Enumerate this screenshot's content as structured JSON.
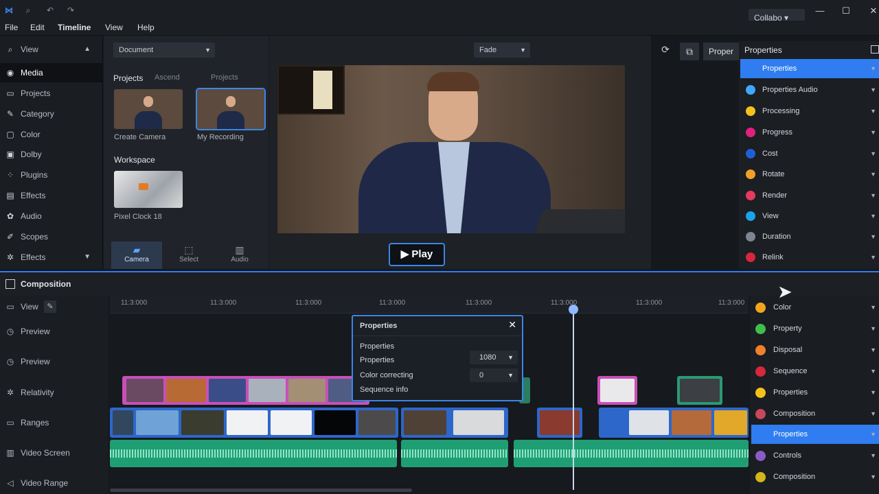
{
  "menu": [
    "File",
    "Edit",
    "Timeline",
    "View",
    "Help"
  ],
  "collab_label": "Collabo",
  "sidebar": {
    "header": "View",
    "items": [
      {
        "label": "Media",
        "icon": "media-icon"
      },
      {
        "label": "Projects",
        "icon": "projects-icon"
      },
      {
        "label": "Category",
        "icon": "category-icon"
      },
      {
        "label": "Color",
        "icon": "color-icon"
      },
      {
        "label": "Dolby",
        "icon": "dolby-icon"
      },
      {
        "label": "Plugins",
        "icon": "plugins-icon"
      },
      {
        "label": "Effects",
        "icon": "effects-icon"
      },
      {
        "label": "Audio",
        "icon": "audio-icon"
      },
      {
        "label": "Scopes",
        "icon": "scopes-icon"
      },
      {
        "label": "Effects",
        "icon": "fx-icon"
      }
    ]
  },
  "media": {
    "dropdown": "Document",
    "projects_label": "Projects",
    "filter1": "Ascend",
    "filter2": "Projects",
    "clip1": "Create Camera",
    "clip2": "My Recording",
    "section2": "Workspace",
    "clip3": "Pixel Clock 18",
    "tabs": [
      "Camera",
      "Select",
      "Audio"
    ]
  },
  "preview": {
    "resolution": "Fade",
    "play_label": "Play",
    "props_btn": "Proper"
  },
  "properties": {
    "title": "Properties",
    "rows": [
      {
        "label": "Properties",
        "color": "#2f7df0",
        "active": true
      },
      {
        "label": "Properties Audio",
        "color": "#3ea7ff"
      },
      {
        "label": "Processing",
        "color": "#f3c21b"
      },
      {
        "label": "Progress",
        "color": "#e0217c"
      },
      {
        "label": "Cost",
        "color": "#1e5fd6"
      },
      {
        "label": "Rotate",
        "color": "#f0a028"
      },
      {
        "label": "Render",
        "color": "#e43a5e"
      },
      {
        "label": "View",
        "color": "#1aa3e8"
      },
      {
        "label": "Duration",
        "color": "#7d8592"
      },
      {
        "label": "Relink",
        "color": "#d7263d"
      }
    ]
  },
  "timeline": {
    "title": "Composition",
    "ticks": [
      "11:3:000",
      "11:3:000",
      "11:3:000",
      "11:3:000",
      "11:3:000",
      "11:3:000",
      "11:3:000",
      "11:3:000"
    ],
    "tracks": [
      "View",
      "Preview",
      "Preview",
      "Relativity",
      "Ranges",
      "Video Screen",
      "Video Range"
    ]
  },
  "popup": {
    "title": "Properties",
    "line1": "Properties",
    "line2": "Properties",
    "value2": "1080",
    "line3": "Color correcting",
    "value3": "0",
    "line4": "Sequence info"
  },
  "tl_panel": {
    "rows": [
      {
        "label": "Color",
        "color": "#f3a61b"
      },
      {
        "label": "Property",
        "color": "#3fbf4a"
      },
      {
        "label": "Disposal",
        "color": "#f0802a"
      },
      {
        "label": "Sequence",
        "color": "#d7263d"
      },
      {
        "label": "Properties",
        "color": "#f3c21b"
      },
      {
        "label": "Composition",
        "color": "#c7475d"
      },
      {
        "label": "Properties",
        "color": "#2f7df0",
        "active": true
      },
      {
        "label": "Controls",
        "color": "#8a5cc7"
      },
      {
        "label": "Composition",
        "color": "#d4b51c"
      }
    ]
  }
}
